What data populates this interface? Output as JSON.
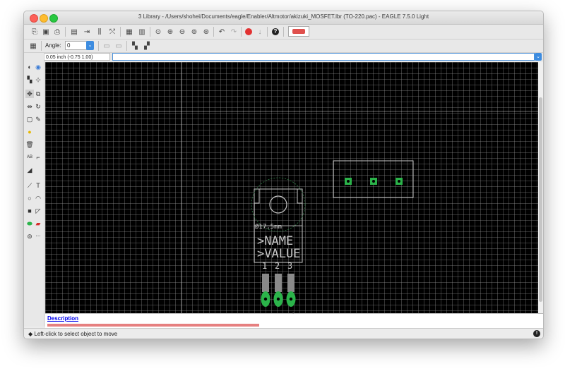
{
  "window": {
    "title": "3 Library - /Users/shohei/Documents/eagle/Enabler/Altmotor/akizuki_MOSFET.lbr (TO-220.pac) - EAGLE 7.5.0 Light"
  },
  "toolbar2": {
    "angle_label": "Angle:",
    "angle_value": "0"
  },
  "coordinates": {
    "readout": "0.05 inch (-0.75 1.00)"
  },
  "canvas": {
    "diameter_label": "Ø17,5mm",
    "name_placeholder": ">NAME",
    "value_placeholder": ">VALUE",
    "pin_numbers": [
      "1",
      "2",
      "3"
    ]
  },
  "description": {
    "link": "Description"
  },
  "status": {
    "message": "Left-click to select object to move"
  },
  "colors": {
    "canvas_bg": "#000000",
    "pad_green": "#2bb34a",
    "outline": "#c9c9c9"
  }
}
